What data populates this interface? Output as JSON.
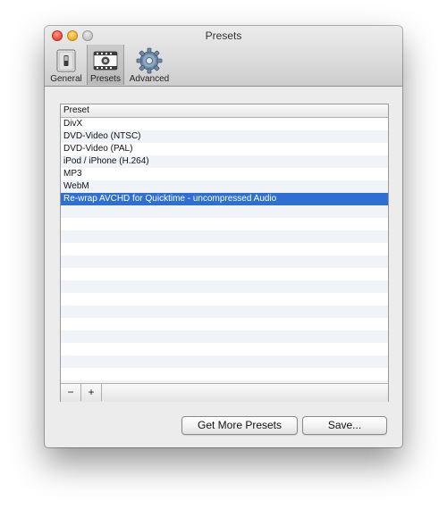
{
  "window": {
    "title": "Presets"
  },
  "toolbar": {
    "items": [
      {
        "label": "General",
        "icon": "general-switch-icon"
      },
      {
        "label": "Presets",
        "icon": "presets-film-icon",
        "selected": true
      },
      {
        "label": "Advanced",
        "icon": "gear-icon"
      }
    ]
  },
  "presets_list": {
    "header": "Preset",
    "rows": [
      {
        "label": "DivX"
      },
      {
        "label": "DVD-Video (NTSC)"
      },
      {
        "label": "DVD-Video (PAL)"
      },
      {
        "label": "iPod / iPhone (H.264)"
      },
      {
        "label": "MP3"
      },
      {
        "label": "WebM"
      },
      {
        "label": "Re-wrap AVCHD for Quicktime - uncompressed Audio",
        "selected": true
      }
    ],
    "remove_label": "−",
    "add_label": "+"
  },
  "buttons": {
    "get_more": "Get More Presets",
    "save": "Save..."
  },
  "colors": {
    "selection": "#2f6fd0",
    "window_bg": "#ececec"
  }
}
